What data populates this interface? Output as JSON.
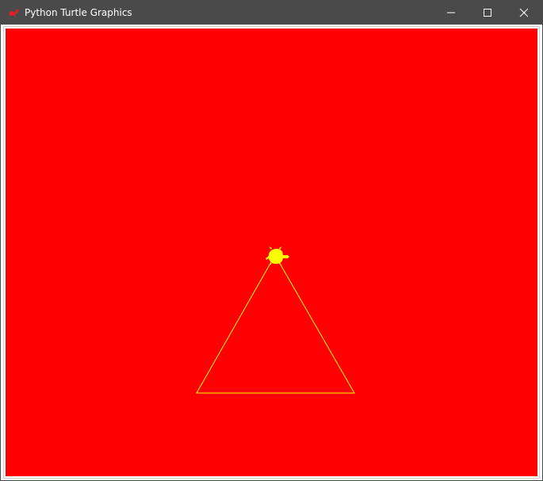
{
  "window": {
    "title": "Python Turtle Graphics",
    "titlebar_color": "#4a4a4a",
    "title_text_color": "#ffffff",
    "icons": {
      "app": "turtle-app-icon",
      "minimize": "minimize-icon",
      "maximize": "maximize-icon",
      "close": "close-icon"
    }
  },
  "canvas": {
    "background_color": "#ff0000",
    "pen_color": "#ffff00",
    "drawing": {
      "shape": "triangle"
    },
    "turtle": {
      "color": "#ffff00",
      "heading": "east",
      "icon": "turtle-icon"
    }
  }
}
